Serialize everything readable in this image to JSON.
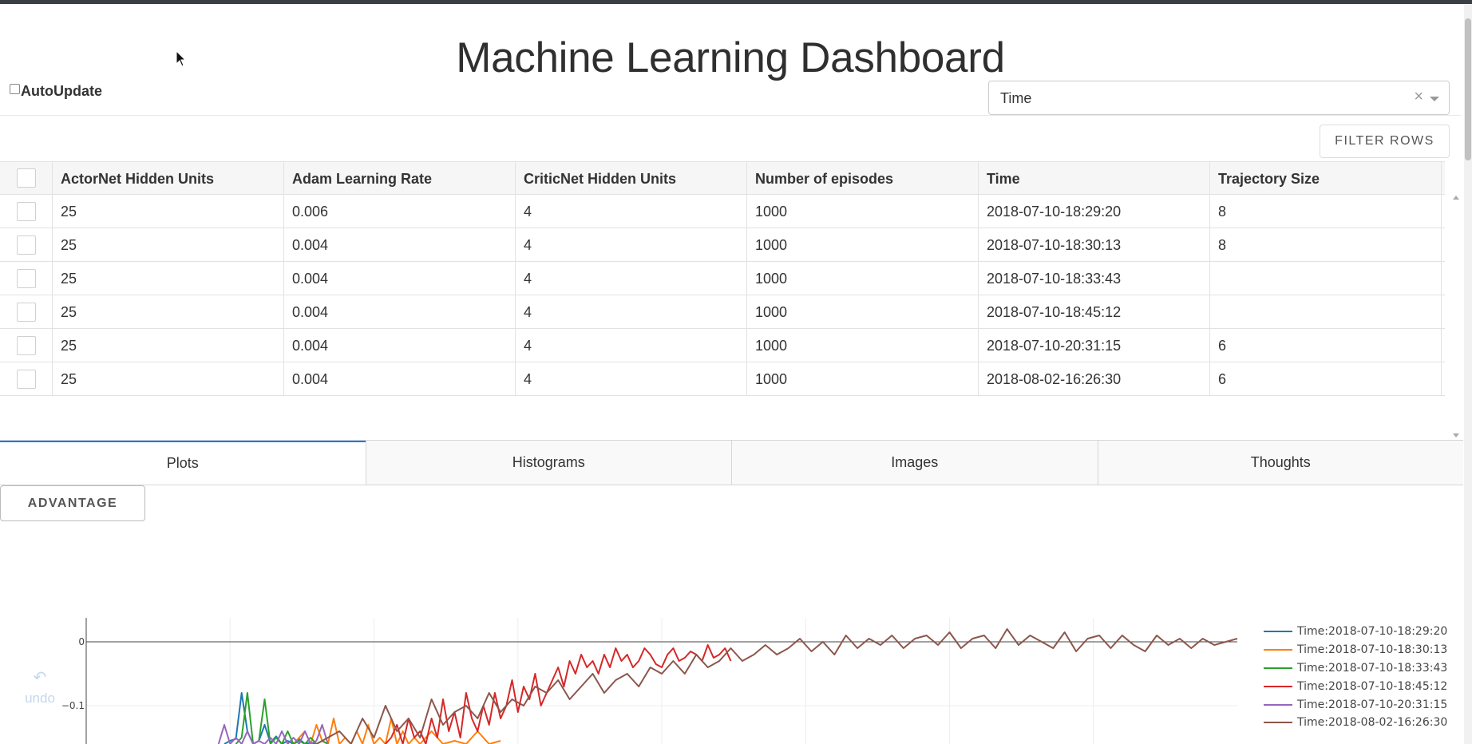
{
  "title": "Machine Learning Dashboard",
  "autoupdate": {
    "label": "AutoUpdate",
    "checked": false
  },
  "sort_select": {
    "value": "Time",
    "clear_glyph": "×"
  },
  "filter_button": "FILTER ROWS",
  "table": {
    "columns": [
      "ActorNet Hidden Units",
      "Adam Learning Rate",
      "CriticNet Hidden Units",
      "Number of episodes",
      "Time",
      "Trajectory Size"
    ],
    "rows": [
      [
        "25",
        "0.006",
        "4",
        "1000",
        "2018-07-10-18:29:20",
        "8"
      ],
      [
        "25",
        "0.004",
        "4",
        "1000",
        "2018-07-10-18:30:13",
        "8"
      ],
      [
        "25",
        "0.004",
        "4",
        "1000",
        "2018-07-10-18:33:43",
        ""
      ],
      [
        "25",
        "0.004",
        "4",
        "1000",
        "2018-07-10-18:45:12",
        ""
      ],
      [
        "25",
        "0.004",
        "4",
        "1000",
        "2018-07-10-20:31:15",
        "6"
      ],
      [
        "25",
        "0.004",
        "4",
        "1000",
        "2018-08-02-16:26:30",
        "6"
      ]
    ]
  },
  "tabs": [
    {
      "label": "Plots",
      "active": true
    },
    {
      "label": "Histograms",
      "active": false
    },
    {
      "label": "Images",
      "active": false
    },
    {
      "label": "Thoughts",
      "active": false
    }
  ],
  "metric_button": "ADVANTAGE",
  "undo": {
    "icon": "undo-icon",
    "label": "undo"
  },
  "chart_data": {
    "type": "line",
    "title": "",
    "xlabel": "",
    "ylabel": "",
    "ytick_labels": [
      "0",
      "−0.1"
    ],
    "ylim": [
      -0.16,
      0.055
    ],
    "xlim": [
      0,
      1000
    ],
    "grid": true,
    "legend_position": "right",
    "series": [
      {
        "name": "Time:2018-07-10-18:29:20",
        "color": "#1f77b4",
        "x": [
          120,
          125,
          130,
          135,
          140,
          145,
          150,
          155,
          160,
          165,
          170,
          175,
          180,
          185,
          190,
          195,
          200
        ],
        "y": [
          -0.16,
          -0.155,
          -0.152,
          -0.08,
          -0.14,
          -0.16,
          -0.155,
          -0.13,
          -0.158,
          -0.148,
          -0.16,
          -0.155,
          -0.16,
          -0.152,
          -0.16,
          -0.158,
          -0.16
        ]
      },
      {
        "name": "Time:2018-07-10-18:30:13",
        "color": "#ff7f0e",
        "x": [
          180,
          185,
          190,
          195,
          200,
          205,
          210,
          215,
          220,
          225,
          230,
          235,
          240,
          245,
          250,
          255,
          260,
          265,
          270,
          275,
          280,
          285,
          290,
          300,
          310,
          320,
          330,
          340,
          350,
          360
        ],
        "y": [
          -0.16,
          -0.15,
          -0.14,
          -0.16,
          -0.13,
          -0.155,
          -0.16,
          -0.12,
          -0.16,
          -0.15,
          -0.16,
          -0.14,
          -0.16,
          -0.13,
          -0.16,
          -0.15,
          -0.16,
          -0.12,
          -0.16,
          -0.14,
          -0.16,
          -0.15,
          -0.16,
          -0.14,
          -0.16,
          -0.155,
          -0.16,
          -0.14,
          -0.16,
          -0.155
        ]
      },
      {
        "name": "Time:2018-07-10-18:33:43",
        "color": "#2ca02c",
        "x": [
          130,
          135,
          140,
          145,
          150,
          155,
          160,
          165,
          170,
          175,
          180,
          185,
          190,
          195,
          200,
          205,
          210
        ],
        "y": [
          -0.16,
          -0.15,
          -0.08,
          -0.16,
          -0.155,
          -0.09,
          -0.16,
          -0.15,
          -0.16,
          -0.14,
          -0.16,
          -0.155,
          -0.16,
          -0.15,
          -0.16,
          -0.155,
          -0.16
        ]
      },
      {
        "name": "Time:2018-07-10-18:45:12",
        "color": "#d62728",
        "x": [
          260,
          265,
          270,
          275,
          280,
          285,
          290,
          295,
          300,
          305,
          310,
          315,
          320,
          325,
          330,
          335,
          340,
          345,
          350,
          355,
          360,
          365,
          370,
          375,
          380,
          385,
          390,
          395,
          400,
          405,
          410,
          415,
          420,
          425,
          430,
          435,
          440,
          445,
          450,
          455,
          460,
          465,
          470,
          475,
          480,
          485,
          490,
          495,
          500,
          505,
          510,
          515,
          520,
          525,
          530,
          535,
          540,
          545,
          550,
          555,
          560
        ],
        "y": [
          -0.16,
          -0.15,
          -0.13,
          -0.16,
          -0.12,
          -0.15,
          -0.14,
          -0.16,
          -0.12,
          -0.15,
          -0.09,
          -0.14,
          -0.11,
          -0.15,
          -0.08,
          -0.12,
          -0.14,
          -0.1,
          -0.13,
          -0.08,
          -0.12,
          -0.1,
          -0.06,
          -0.11,
          -0.07,
          -0.09,
          -0.05,
          -0.1,
          -0.08,
          -0.06,
          -0.04,
          -0.07,
          -0.03,
          -0.05,
          -0.02,
          -0.04,
          -0.03,
          -0.05,
          -0.02,
          -0.04,
          -0.01,
          -0.03,
          -0.02,
          -0.04,
          -0.03,
          -0.01,
          -0.02,
          -0.035,
          -0.04,
          -0.02,
          -0.01,
          -0.03,
          -0.025,
          -0.015,
          -0.02,
          -0.03,
          -0.005,
          -0.025,
          -0.02,
          -0.01,
          -0.03
        ]
      },
      {
        "name": "Time:2018-07-10-20:31:15",
        "color": "#9467bd",
        "x": [
          115,
          120,
          125,
          130,
          135,
          140,
          145,
          150,
          155,
          160,
          165,
          170,
          175,
          180,
          185,
          190,
          195,
          200,
          205,
          210
        ],
        "y": [
          -0.16,
          -0.13,
          -0.16,
          -0.15,
          -0.16,
          -0.14,
          -0.16,
          -0.155,
          -0.16,
          -0.15,
          -0.16,
          -0.14,
          -0.16,
          -0.15,
          -0.16,
          -0.14,
          -0.16,
          -0.155,
          -0.13,
          -0.16
        ]
      },
      {
        "name": "Time:2018-08-02-16:26:30",
        "color": "#8c564b",
        "x": [
          200,
          210,
          220,
          230,
          240,
          250,
          260,
          270,
          280,
          290,
          300,
          310,
          320,
          330,
          340,
          350,
          360,
          370,
          380,
          390,
          400,
          410,
          420,
          430,
          440,
          450,
          460,
          470,
          480,
          490,
          500,
          510,
          520,
          530,
          540,
          550,
          560,
          570,
          580,
          590,
          600,
          610,
          620,
          630,
          640,
          650,
          660,
          670,
          680,
          690,
          700,
          710,
          720,
          730,
          740,
          750,
          760,
          770,
          780,
          790,
          800,
          810,
          820,
          830,
          840,
          850,
          860,
          870,
          880,
          890,
          900,
          910,
          920,
          930,
          940,
          950,
          960,
          970,
          980,
          990,
          1000
        ],
        "y": [
          -0.16,
          -0.15,
          -0.14,
          -0.16,
          -0.12,
          -0.15,
          -0.1,
          -0.14,
          -0.12,
          -0.15,
          -0.09,
          -0.13,
          -0.11,
          -0.1,
          -0.12,
          -0.08,
          -0.11,
          -0.09,
          -0.1,
          -0.07,
          -0.08,
          -0.06,
          -0.09,
          -0.07,
          -0.05,
          -0.08,
          -0.06,
          -0.05,
          -0.07,
          -0.04,
          -0.05,
          -0.03,
          -0.05,
          -0.02,
          -0.04,
          -0.03,
          -0.01,
          -0.03,
          -0.02,
          -0.005,
          -0.02,
          -0.01,
          0.005,
          -0.015,
          0,
          -0.02,
          0.01,
          -0.01,
          0.005,
          -0.005,
          0.01,
          -0.01,
          0.005,
          0.01,
          -0.005,
          0.015,
          -0.01,
          0.005,
          0.01,
          -0.01,
          0.02,
          -0.005,
          0.01,
          0,
          -0.01,
          0.015,
          -0.015,
          0.005,
          0.01,
          -0.01,
          0.01,
          -0.005,
          -0.015,
          0.01,
          -0.005,
          0.005,
          -0.01,
          0.005,
          -0.005,
          0.0,
          0.005
        ]
      }
    ]
  }
}
